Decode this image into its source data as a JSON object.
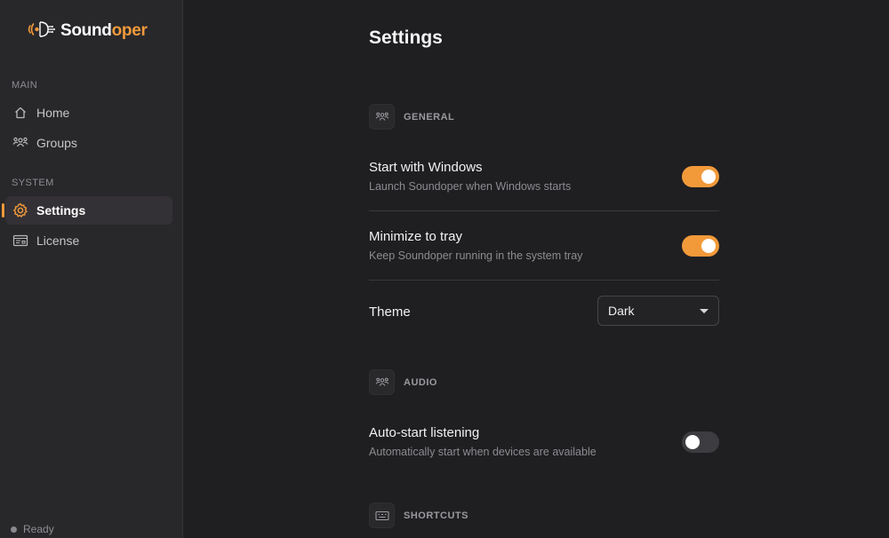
{
  "app": {
    "name_part1": "Sound",
    "name_part2": "oper",
    "brand_color": "#f29a3a"
  },
  "sidebar": {
    "sections": [
      {
        "label": "MAIN"
      },
      {
        "label": "SYSTEM"
      }
    ],
    "items": [
      {
        "label": "Home",
        "icon": "home-icon",
        "active": false
      },
      {
        "label": "Groups",
        "icon": "groups-icon",
        "active": false
      },
      {
        "label": "Settings",
        "icon": "gear-icon",
        "active": true
      },
      {
        "label": "License",
        "icon": "license-icon",
        "active": false
      }
    ],
    "status": "Ready"
  },
  "page": {
    "title": "Settings"
  },
  "groups": {
    "general": {
      "label": "GENERAL",
      "icon": "groups-icon"
    },
    "audio": {
      "label": "AUDIO",
      "icon": "groups-icon"
    },
    "shortcuts": {
      "label": "SHORTCUTS",
      "icon": "keyboard-icon"
    }
  },
  "settings": {
    "start_with_windows": {
      "title": "Start with Windows",
      "description": "Launch Soundoper when Windows starts",
      "enabled": true
    },
    "minimize_to_tray": {
      "title": "Minimize to tray",
      "description": "Keep Soundoper running in the system tray",
      "enabled": true
    },
    "theme": {
      "title": "Theme",
      "value": "Dark"
    },
    "auto_start_listening": {
      "title": "Auto-start listening",
      "description": "Automatically start when devices are available",
      "enabled": false
    }
  }
}
